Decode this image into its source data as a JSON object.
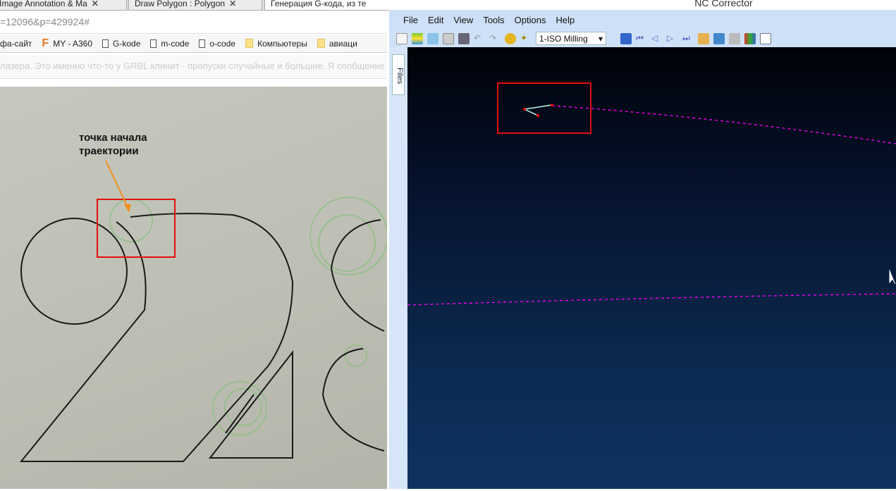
{
  "browser": {
    "tabs": [
      {
        "label": "Image Annotation & Ma"
      },
      {
        "label": "Draw Polygon : Polygon"
      },
      {
        "label": "Генерация G-кода, из те"
      }
    ],
    "address": "=12096&p=429924#",
    "bookmarks": [
      {
        "label": "фа-сайт",
        "icon": "none"
      },
      {
        "label": "MY - A360",
        "icon": "fusion-icon"
      },
      {
        "label": "G-kode",
        "icon": "page-icon"
      },
      {
        "label": "m-code",
        "icon": "page-icon"
      },
      {
        "label": "o-code",
        "icon": "page-icon"
      },
      {
        "label": "Компьютеры",
        "icon": "folder-icon"
      },
      {
        "label": "авиаци",
        "icon": "folder-icon"
      }
    ],
    "faded_text": "лазера. Это именно что-то у GRBL клинит - пропуски случайные и большие. Я сообщение",
    "annotation": {
      "line1": "точка начала",
      "line2": "траектории"
    }
  },
  "nc": {
    "title": "NC Corrector",
    "menu": [
      "File",
      "Edit",
      "View",
      "Tools",
      "Options",
      "Help"
    ],
    "machine_select": "1-ISO Milling",
    "side_tab": "Files",
    "colors": {
      "path": "#ff00ff",
      "highlight": "#e00000",
      "bg_top": "#000208",
      "bg_bottom": "#0e3360"
    }
  }
}
